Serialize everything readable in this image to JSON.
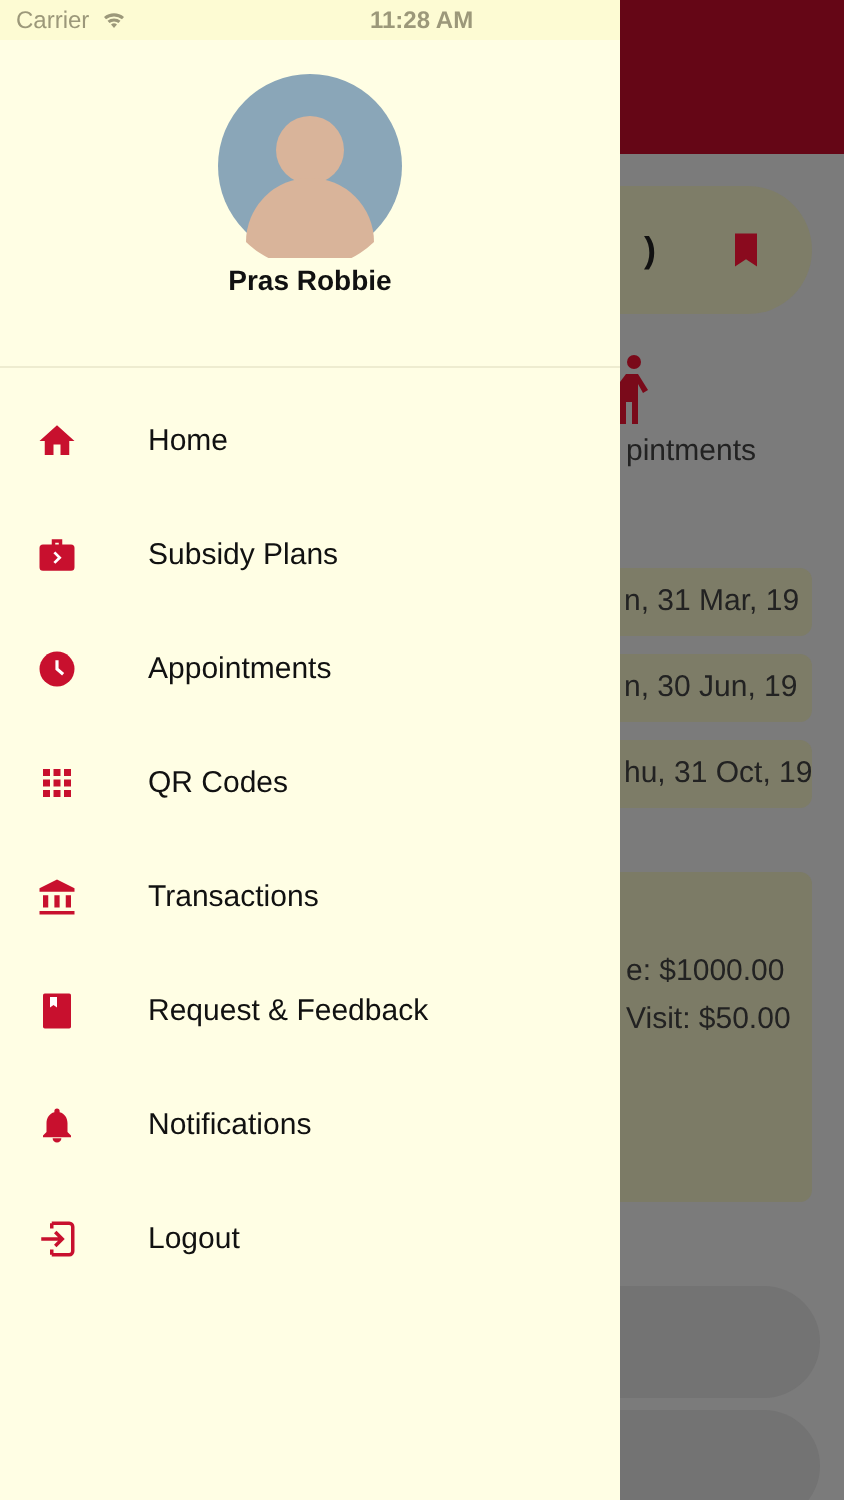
{
  "status_bar": {
    "carrier": "Carrier",
    "time": "11:28 AM"
  },
  "drawer": {
    "user_name": "Pras Robbie",
    "menu": [
      {
        "label": "Home",
        "kind": "home"
      },
      {
        "label": "Subsidy Plans",
        "kind": "briefcase"
      },
      {
        "label": "Appointments",
        "kind": "clock"
      },
      {
        "label": "QR Codes",
        "kind": "grid"
      },
      {
        "label": "Transactions",
        "kind": "bank"
      },
      {
        "label": "Request & Feedback",
        "kind": "book"
      },
      {
        "label": "Notifications",
        "kind": "bell"
      },
      {
        "label": "Logout",
        "kind": "logout"
      }
    ]
  },
  "background": {
    "card_text": ")",
    "section_label": "pintments",
    "dates": [
      "n, 31 Mar, 19",
      "n, 30 Jun, 19",
      "hu, 31 Oct, 19"
    ],
    "info_lines": [
      "e: $1000.00",
      "Visit: $50.00"
    ]
  }
}
